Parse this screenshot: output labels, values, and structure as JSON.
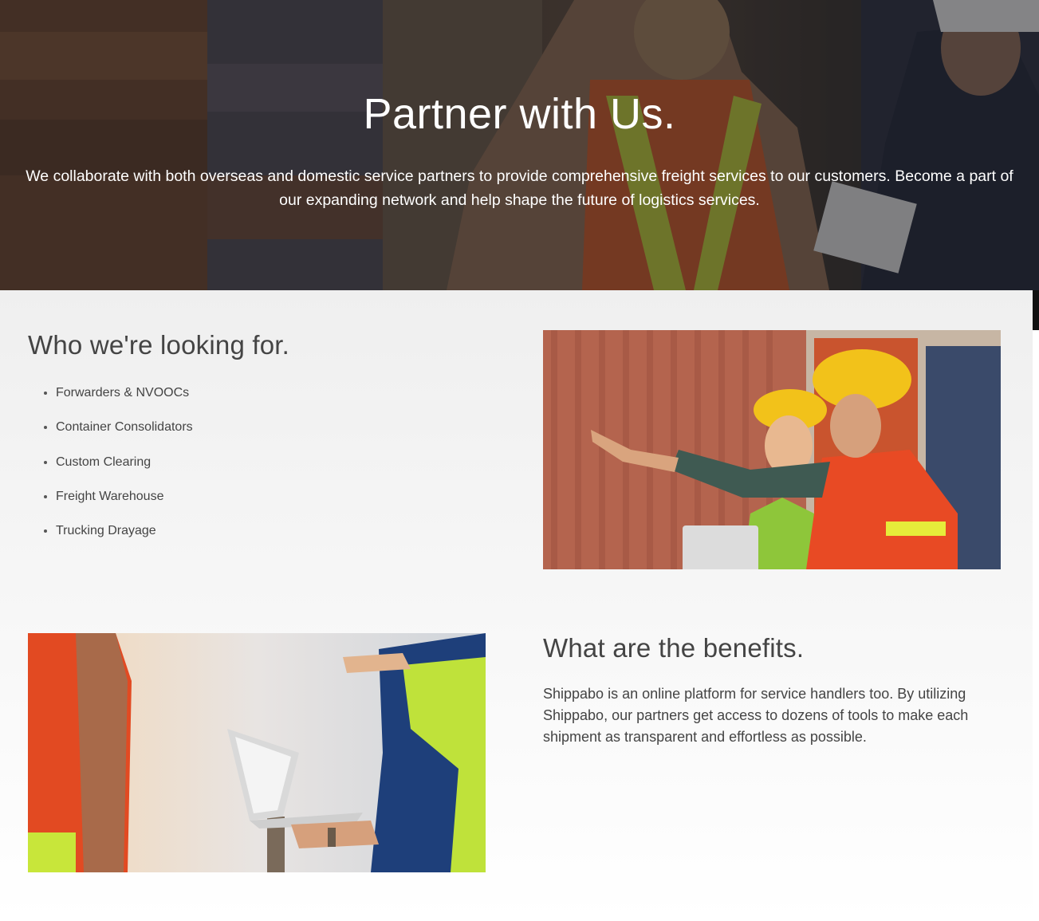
{
  "hero": {
    "title": "Partner with Us.",
    "subtitle": "We collaborate with both overseas and domestic service partners to provide comprehensive freight services to our customers. Become a part of our expanding network and help shape the future of logistics services."
  },
  "who": {
    "heading": "Who we're looking for.",
    "items": [
      "Forwarders & NVOOCs",
      "Container Consolidators",
      "Custom Clearing",
      "Freight Warehouse",
      "Trucking Drayage"
    ]
  },
  "benefits": {
    "heading": "What are the benefits.",
    "text": "Shippabo is an online platform for service handlers too. By utilizing Shippabo, our partners get access to dozens of tools to make each shipment as transparent and effortless as possible."
  },
  "colors": {
    "heading_text": "#444444",
    "hero_text": "#ffffff",
    "hard_hat": "#f2c21a",
    "safety_vest": "#e8552a",
    "hi_vis": "#c8e63a"
  }
}
